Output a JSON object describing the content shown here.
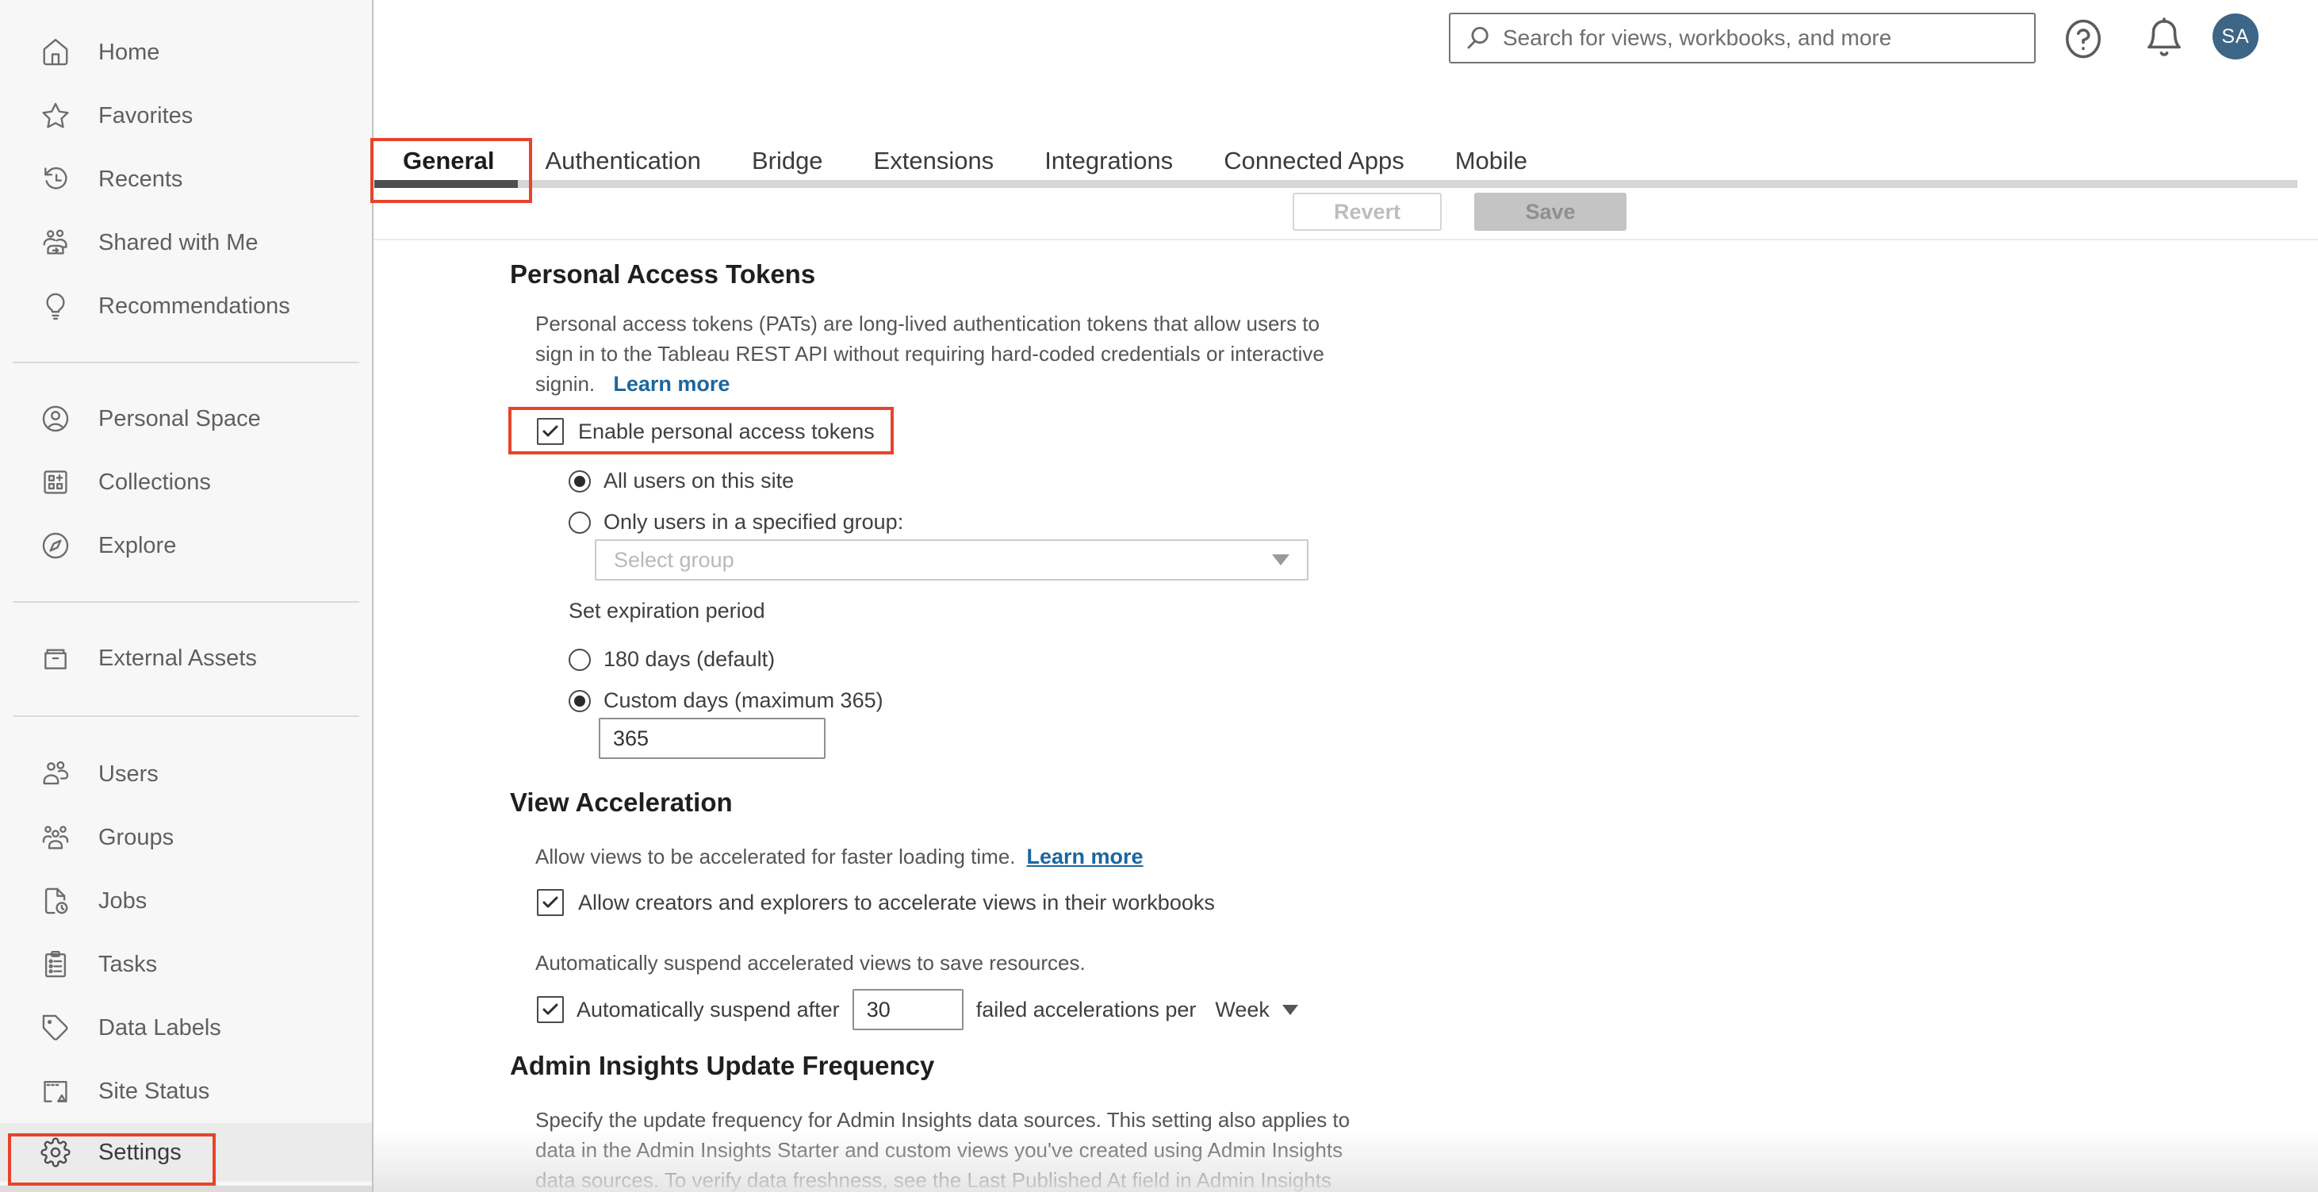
{
  "topbar": {
    "search_placeholder": "Search for views, workbooks, and more",
    "avatar_initials": "SA"
  },
  "sidebar": {
    "items": [
      {
        "label": "Home"
      },
      {
        "label": "Favorites"
      },
      {
        "label": "Recents"
      },
      {
        "label": "Shared with Me"
      },
      {
        "label": "Recommendations"
      },
      {
        "label": "Personal Space"
      },
      {
        "label": "Collections"
      },
      {
        "label": "Explore"
      },
      {
        "label": "External Assets"
      },
      {
        "label": "Users"
      },
      {
        "label": "Groups"
      },
      {
        "label": "Jobs"
      },
      {
        "label": "Tasks"
      },
      {
        "label": "Data Labels"
      },
      {
        "label": "Site Status"
      },
      {
        "label": "Settings"
      }
    ],
    "active_item": "Settings"
  },
  "tabs": {
    "items": [
      {
        "label": "General",
        "active": true
      },
      {
        "label": "Authentication",
        "active": false
      },
      {
        "label": "Bridge",
        "active": false
      },
      {
        "label": "Extensions",
        "active": false
      },
      {
        "label": "Integrations",
        "active": false
      },
      {
        "label": "Connected Apps",
        "active": false
      },
      {
        "label": "Mobile",
        "active": false
      }
    ]
  },
  "toolbar": {
    "revert_label": "Revert",
    "save_label": "Save"
  },
  "pat": {
    "title": "Personal Access Tokens",
    "desc_line1": "Personal access tokens (PATs) are long-lived authentication tokens that allow users to",
    "desc_line2": "sign in to the Tableau REST API without requiring hard-coded credentials or interactive",
    "desc_line3": "signin.",
    "learn_more": "Learn more",
    "enable_label": "Enable personal access tokens",
    "enable_checked": true,
    "radio_all_users": "All users on this site",
    "radio_specified_group": "Only users in a specified group:",
    "group_select_placeholder": "Select group",
    "expiration_label": "Set expiration period",
    "radio_180": "180 days (default)",
    "radio_custom": "Custom days (maximum 365)",
    "custom_days_value": "365"
  },
  "view_acceleration": {
    "title": "View Acceleration",
    "desc": "Allow views to be accelerated for faster loading time.",
    "learn_more": "Learn more",
    "allow_label": "Allow creators and explorers to accelerate views in their workbooks",
    "suspend_desc": "Automatically suspend accelerated views to save resources.",
    "suspend_label": "Automatically suspend after",
    "suspend_value": "30",
    "suspend_suffix": "failed accelerations per",
    "suspend_period": "Week"
  },
  "admin_insights": {
    "title": "Admin Insights Update Frequency",
    "desc_line1": "Specify the update frequency for Admin Insights data sources. This setting also applies to",
    "desc_line2": "data in the Admin Insights Starter and custom views you've created using Admin Insights",
    "desc_line3": "data sources. To verify data freshness, see the Last Published At field in Admin Insights"
  },
  "colors": {
    "annotation_red": "#e8432a",
    "avatar_bg": "#3d6586",
    "link_blue": "#1b679d",
    "sidebar_bg": "#f7f7f7",
    "active_row_bg": "#ebebeb"
  }
}
